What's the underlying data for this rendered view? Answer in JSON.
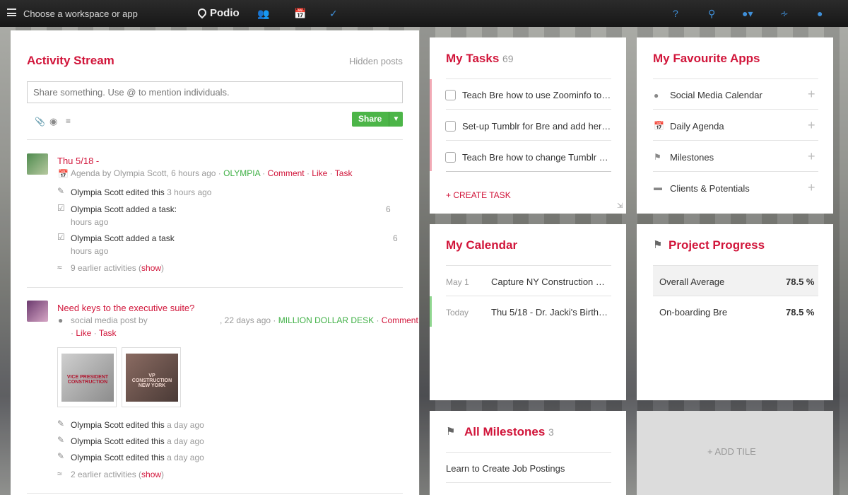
{
  "topbar": {
    "workspace_label": "Choose a workspace or app",
    "logo": "Podio"
  },
  "activity": {
    "title": "Activity Stream",
    "hidden_posts": "Hidden posts",
    "share_placeholder": "Share something. Use @ to mention individuals.",
    "share_button": "Share",
    "post1": {
      "title": "Thu 5/18 -",
      "meta_prefix": "Agenda by Olympia Scott, 6 hours ago ·",
      "space": "OLYMPIA",
      "actions": [
        "Comment",
        "Like",
        "Task"
      ],
      "activities": [
        {
          "user": "Olympia Scott",
          "action": "edited this",
          "time": "3 hours ago"
        },
        {
          "user": "Olympia Scott",
          "action": "added a task:",
          "num": "6",
          "time": "hours ago"
        },
        {
          "user": "Olympia Scott",
          "action": "added a task",
          "num": "6",
          "time": "hours ago"
        }
      ],
      "earlier_prefix": "9 earlier activities (",
      "earlier_link": "show",
      "earlier_suffix": ")"
    },
    "post2": {
      "title": "Need keys to the executive suite?",
      "meta_prefix": "social media post by",
      "meta_time": ", 22 days ago ·",
      "space": "MILLION DOLLAR DESK",
      "actions": [
        "Comment",
        "Like",
        "Task"
      ],
      "thumb1_text": "VICE PRESIDENT CONSTRUCTION",
      "thumb2_text": "VP CONSTRUCTION NEW YORK",
      "activities": [
        {
          "user": "Olympia Scott",
          "action": "edited this",
          "time": "a day ago"
        },
        {
          "user": "Olympia Scott",
          "action": "edited this",
          "time": "a day ago"
        },
        {
          "user": "Olympia Scott",
          "action": "edited this",
          "time": "a day ago"
        }
      ],
      "earlier_prefix": "2 earlier activities (",
      "earlier_link": "show",
      "earlier_suffix": ")"
    }
  },
  "tasks": {
    "title": "My Tasks",
    "count": "69",
    "items": [
      "Teach Bre how to use Zoominfo to d...",
      "Set-up Tumblr for Bre and add her t...",
      "Teach Bre how to change Tumblr po..."
    ],
    "create": "+ CREATE TASK"
  },
  "favourites": {
    "title": "My Favourite Apps",
    "items": [
      "Social Media Calendar",
      "Daily Agenda",
      "Milestones",
      "Clients & Potentials"
    ]
  },
  "calendar": {
    "title": "My Calendar",
    "events": [
      {
        "date": "May 1",
        "title": "Capture NY Construction Can..."
      },
      {
        "date": "Today",
        "title": "Thu 5/18 - Dr. Jacki's Birthday"
      }
    ]
  },
  "progress": {
    "title": "Project Progress",
    "rows": [
      {
        "label": "Overall Average",
        "value": "78.5 %"
      },
      {
        "label": "On-boarding Bre",
        "value": "78.5 %"
      }
    ]
  },
  "milestones": {
    "title": "All Milestones",
    "count": "3",
    "items": [
      "Learn to Create Job Postings"
    ]
  },
  "add_tile": "ADD TILE",
  "colors": {
    "accent": "#d1153a",
    "green": "#3fb045",
    "nav": "#3f8fd8"
  }
}
